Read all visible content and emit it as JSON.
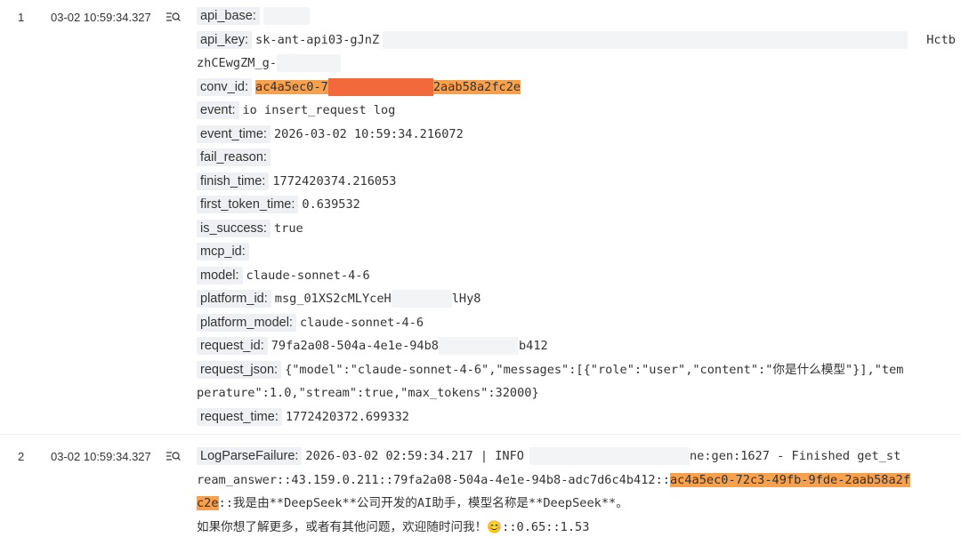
{
  "rows": [
    {
      "num": "1",
      "time": "03-02 10:59:34.327",
      "icon": "list-search-icon",
      "fields": {
        "api_base": {
          "key": "api_base:",
          "value": ""
        },
        "api_key": {
          "key": "api_key:",
          "value_a": "sk-ant-api03-gJnZ",
          "value_b": "Hctb",
          "value_c": "zhCEwgZM_g-"
        },
        "conv_id": {
          "key": "conv_id:",
          "value_a": "ac4a5ec0-7",
          "value_b": "2aab58a2fc2e"
        },
        "event": {
          "key": "event:",
          "value": "io insert_request log"
        },
        "event_time": {
          "key": "event_time:",
          "value": "2026-03-02 10:59:34.216072"
        },
        "fail_reason": {
          "key": "fail_reason:",
          "value": ""
        },
        "finish_time": {
          "key": "finish_time:",
          "value": "1772420374.216053"
        },
        "first_token_time": {
          "key": "first_token_time:",
          "value": "0.639532"
        },
        "is_success": {
          "key": "is_success:",
          "value": "true"
        },
        "mcp_id": {
          "key": "mcp_id:",
          "value": ""
        },
        "model": {
          "key": "model:",
          "value": "claude-sonnet-4-6"
        },
        "platform_id": {
          "key": "platform_id:",
          "value_a": "msg_01XS2cMLYceH",
          "value_b": "lHy8"
        },
        "platform_model": {
          "key": "platform_model:",
          "value": "claude-sonnet-4-6"
        },
        "request_id": {
          "key": "request_id:",
          "value_a": "79fa2a08-504a-4e1e-94b8",
          "value_b": "b412"
        },
        "request_json": {
          "key": "request_json:",
          "line1": "{\"model\":\"claude-sonnet-4-6\",\"messages\":[{\"role\":\"user\",\"content\":\"你是什么模型\"}],\"tem",
          "line2": "perature\":1.0,\"stream\":true,\"max_tokens\":32000}"
        },
        "request_time": {
          "key": "request_time:",
          "value": "1772420372.699332"
        }
      }
    },
    {
      "num": "2",
      "time": "03-02 10:59:34.327",
      "icon": "list-search-icon",
      "log_parse_failure": {
        "key": "LogParseFailure:",
        "line1_a": "2026-03-02 02:59:34.217 | INFO",
        "line1_b": "ne:gen:1627 - Finished get_st",
        "line2_a": "ream_answer::43.159.0.211::79fa2a08-504a-4e1e-94b8-adc7d6c4b412::",
        "line2_hl": "ac4a5ec0-72c3-49fb-9fde-2aab58a2f",
        "line3_hl": "c2e",
        "line3_b": "::我是由**DeepSeek**公司开发的AI助手，模型名称是**DeepSeek**。",
        "line4": "如果你想了解更多，或者有其他问题，欢迎随时问我！😊::0.65::1.53"
      }
    }
  ],
  "colors": {
    "highlight": "#f7a04d",
    "key_bg": "#eef0f3",
    "mask": "#f3f4f6"
  }
}
